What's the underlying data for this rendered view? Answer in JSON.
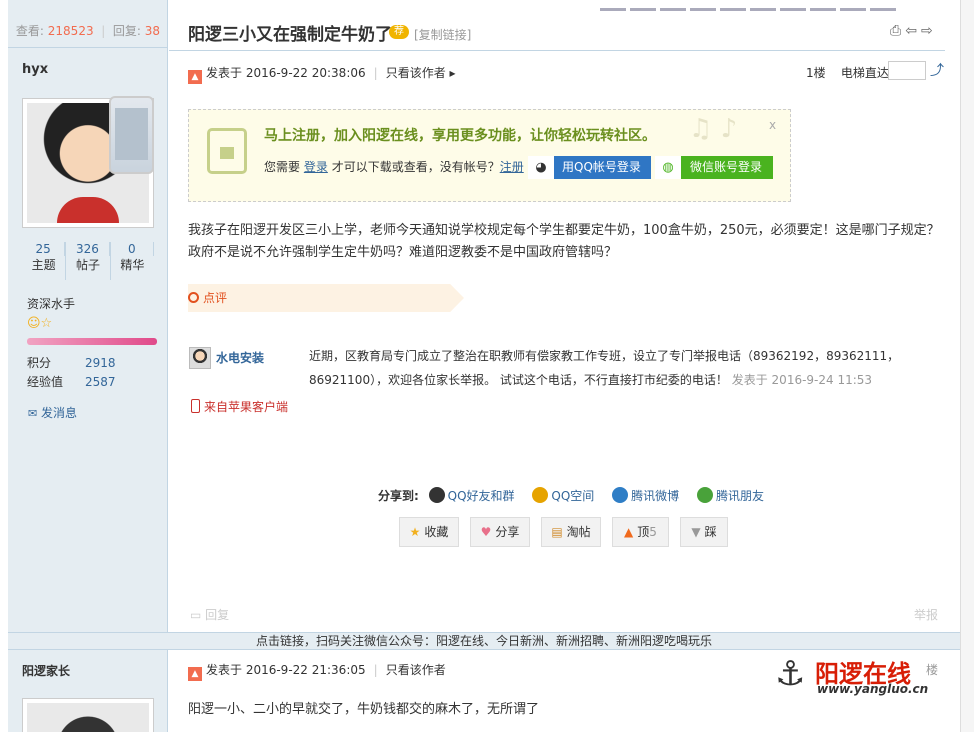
{
  "thread": {
    "views_label": "查看:",
    "views": "218523",
    "replies_label": "回复:",
    "replies": "38",
    "title": "阳逻三小又在强制定牛奶了",
    "badge": "荐",
    "copy_link": "[复制链接]"
  },
  "post1": {
    "author": "hyx",
    "avatar_badge_icon": "apple-icon",
    "stats": [
      {
        "value": "25",
        "label": "主题"
      },
      {
        "value": "326",
        "label": "帖子"
      },
      {
        "value": "0",
        "label": "精华"
      }
    ],
    "rank": "资深水手",
    "rank_icons": "☺☆",
    "points_label": "积分",
    "points": "2918",
    "exp_label": "经验值",
    "exp": "2587",
    "send_msg": "发消息",
    "posted": "发表于 2016-9-22 20:38:06",
    "only_author": "只看该作者",
    "floor": "1楼",
    "jump": "电梯直达",
    "content": "我孩子在阳逻开发区三小上学，老师今天通知说学校规定每个学生都要定牛奶，100盒牛奶，250元，必须要定！这是哪门子规定？政府不是说不允许强制学生定牛奶吗？难道阳逻教委不是中国政府管辖吗？",
    "client": "来自苹果客户端"
  },
  "register_box": {
    "headline": "马上注册，加入阳逻在线，享用更多功能，让你轻松玩转社区。",
    "need_text": "您需要",
    "login": "登录",
    "middle_text": "才可以下载或查看，没有帐号？",
    "register": "注册",
    "qq_login": "用QQ帐号登录",
    "wechat_login": "微信账号登录",
    "close": "x"
  },
  "comments": {
    "label": "点评",
    "items": [
      {
        "author": "水电安装",
        "text": "近期，区教育局专门成立了整治在职教师有偿家教工作专班，设立了专门举报电话（89362192，89362111，86921100），欢迎各位家长举报。 试试这个电话，不行直接打市纪委的电话！",
        "time": "发表于 2016-9-24 11:53"
      }
    ]
  },
  "share": {
    "label": "分享到:",
    "targets": [
      "QQ好友和群",
      "QQ空间",
      "腾讯微博",
      "腾讯朋友"
    ],
    "colors": [
      "#333333",
      "#e6a300",
      "#2f7ec6",
      "#49a23a"
    ]
  },
  "actions": {
    "favorite": "收藏",
    "share": "分享",
    "taotie": "淘帖",
    "up": "顶",
    "up_count": "5",
    "down": "踩"
  },
  "footer": {
    "reply": "回复",
    "report": "举报",
    "wechat_bar": "点击链接，扫码关注微信公众号：阳逻在线、今日新洲、新洲招聘、新洲阳逻吃喝玩乐"
  },
  "post2": {
    "author": "阳逻家长",
    "posted": "发表于 2016-9-22 21:36:05",
    "only_author": "只看该作者",
    "floor": "楼",
    "content": "阳逻一小、二小的早就交了，牛奶钱都交的麻木了，无所谓了"
  },
  "watermark": {
    "name": "阳逻在线",
    "url": "www.yangluo.cn"
  }
}
